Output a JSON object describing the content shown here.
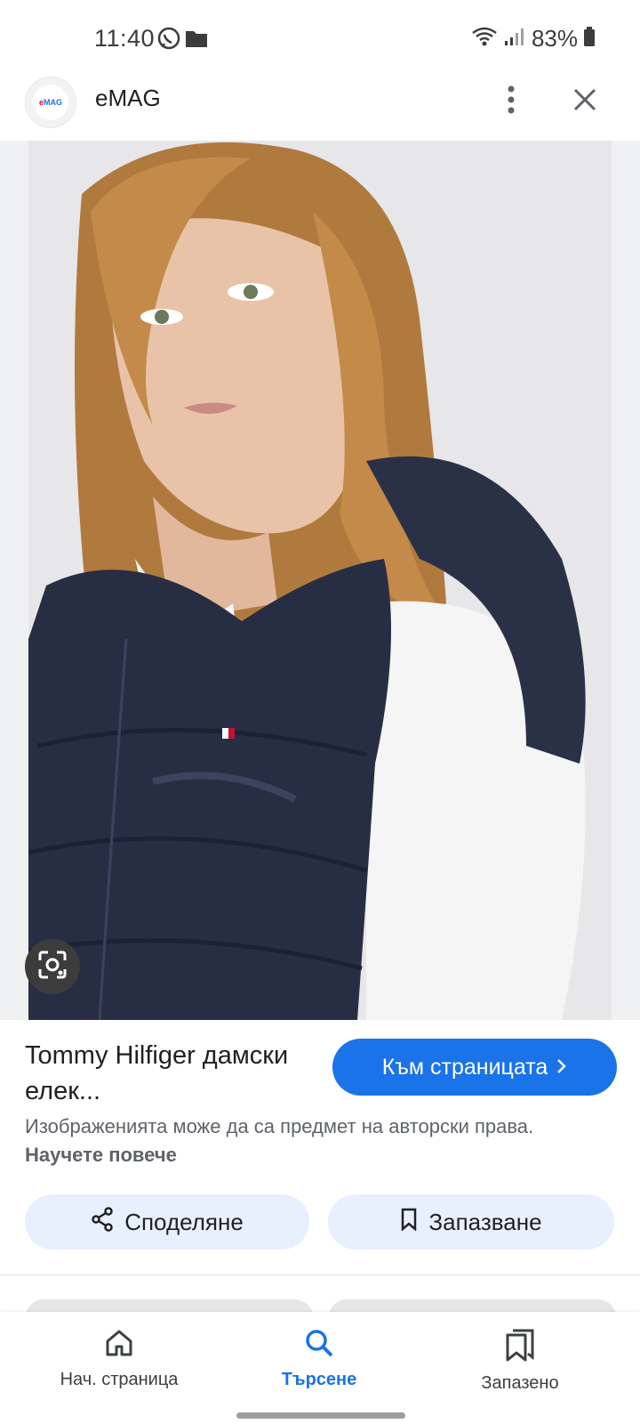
{
  "status_bar": {
    "time": "11:40",
    "battery": "83%",
    "icons": [
      "viber-icon",
      "folder-icon",
      "wifi-icon",
      "signal-icon",
      "battery-icon"
    ]
  },
  "header": {
    "site_name": "eMAG",
    "logo_text": "eMAG",
    "icons": [
      "more-vert-icon",
      "close-icon"
    ]
  },
  "image": {
    "lens_icon": "google-lens-icon"
  },
  "product": {
    "title": "Tommy Hilfiger дамски елек...",
    "visit_button": "Към страницата",
    "copyright_text": "Изображенията може да са предмет на авторски права.",
    "learn_more": "Научете повече"
  },
  "actions": {
    "share": "Споделяне",
    "save": "Запазване"
  },
  "bottom_nav": {
    "home": "Нач. страница",
    "search": "Търсене",
    "saved": "Запазено"
  },
  "colors": {
    "accent": "#1a73e8",
    "action_bg": "#e8f0fe",
    "brand_red": "#e8003d"
  }
}
